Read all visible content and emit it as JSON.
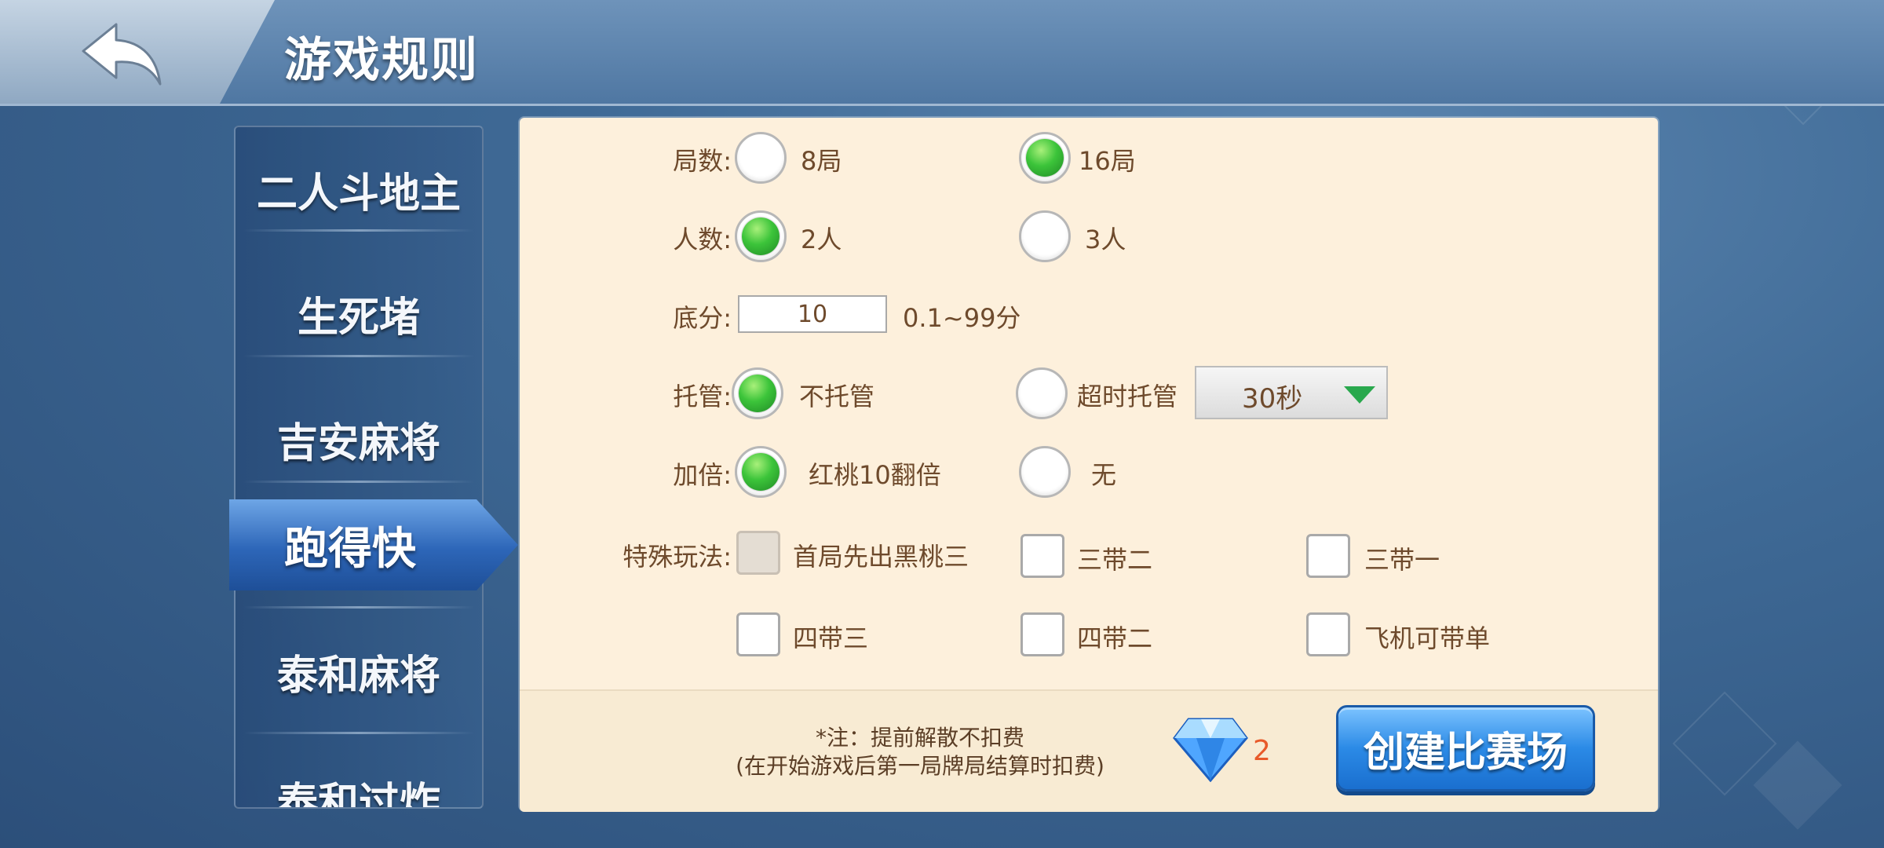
{
  "header": {
    "title": "游戏规则"
  },
  "sidebar": {
    "items": [
      {
        "label": "二人斗地主"
      },
      {
        "label": "生死堵"
      },
      {
        "label": "吉安麻将"
      },
      {
        "label": "跑得快"
      },
      {
        "label": "泰和麻将"
      },
      {
        "label": "泰和过炸"
      }
    ],
    "active_index": 3
  },
  "rules": {
    "rounds": {
      "label": "局数:",
      "options": [
        {
          "label": "8局",
          "selected": false
        },
        {
          "label": "16局",
          "selected": true
        }
      ]
    },
    "players": {
      "label": "人数:",
      "options": [
        {
          "label": "2人",
          "selected": true
        },
        {
          "label": "3人",
          "selected": false
        }
      ]
    },
    "base_score": {
      "label": "底分:",
      "value": "10",
      "hint": "0.1~99分"
    },
    "auto_play": {
      "label": "托管:",
      "options": [
        {
          "label": "不托管",
          "selected": true
        },
        {
          "label": "超时托管",
          "selected": false
        }
      ],
      "timeout_value": "30秒"
    },
    "double": {
      "label": "加倍:",
      "options": [
        {
          "label": "红桃10翻倍",
          "selected": true
        },
        {
          "label": "无",
          "selected": false
        }
      ]
    },
    "special": {
      "label": "特殊玩法:",
      "options": [
        {
          "label": "首局先出黑桃三",
          "checked": false,
          "disabled": true
        },
        {
          "label": "三带二",
          "checked": false
        },
        {
          "label": "三带一",
          "checked": false
        },
        {
          "label": "四带三",
          "checked": false
        },
        {
          "label": "四带二",
          "checked": false
        },
        {
          "label": "飞机可带单",
          "checked": false
        }
      ]
    }
  },
  "footer": {
    "note_line1": "*注：提前解散不扣费",
    "note_line2": "(在开始游戏后第一局牌局结算时扣费)",
    "diamond_count": "2",
    "create_label": "创建比赛场"
  }
}
